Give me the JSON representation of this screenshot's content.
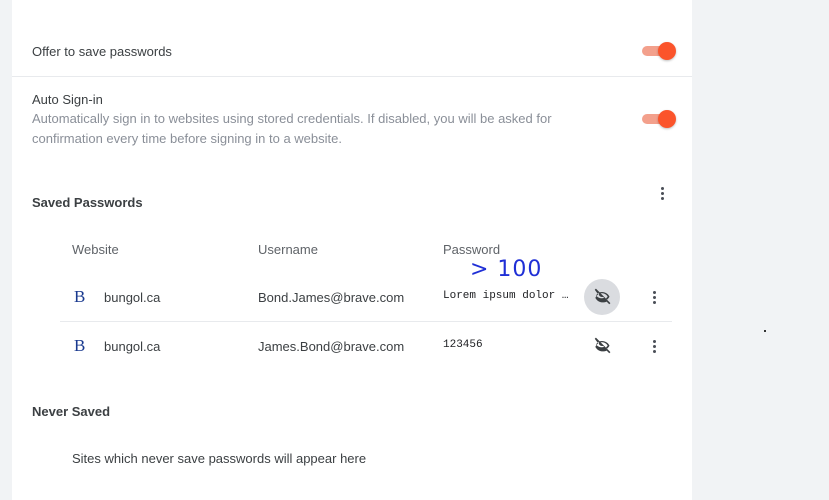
{
  "settings": {
    "offer_save": {
      "label": "Offer to save passwords",
      "enabled": true
    },
    "auto_signin": {
      "label": "Auto Sign-in",
      "description_line1": "Automatically sign in to websites using stored credentials. If disabled, you will be asked for",
      "description_line2": "confirmation every time before signing in to a website.",
      "enabled": true
    }
  },
  "saved_passwords": {
    "title": "Saved Passwords",
    "columns": {
      "website": "Website",
      "username": "Username",
      "password": "Password"
    },
    "rows": [
      {
        "site_icon": "B",
        "site": "bungol.ca",
        "username": "Bond.James@brave.com",
        "password": "Lorem ipsum dolor sit amet"
      },
      {
        "site_icon": "B",
        "site": "bungol.ca",
        "username": "James.Bond@brave.com",
        "password": "123456"
      }
    ]
  },
  "never_saved": {
    "title": "Never Saved",
    "empty_message": "Sites which never save passwords will appear here"
  },
  "annotation": {
    "text": "> 100"
  },
  "colors": {
    "accent": "#fb542b",
    "accent_track": "#f3a08c",
    "site_icon": "#1a3a8f",
    "annotation_ink": "#1f2fd6"
  },
  "icons": {
    "toggle": "toggle-switch",
    "more": "kebab-menu-icon",
    "visibility": "eye-off-icon"
  }
}
